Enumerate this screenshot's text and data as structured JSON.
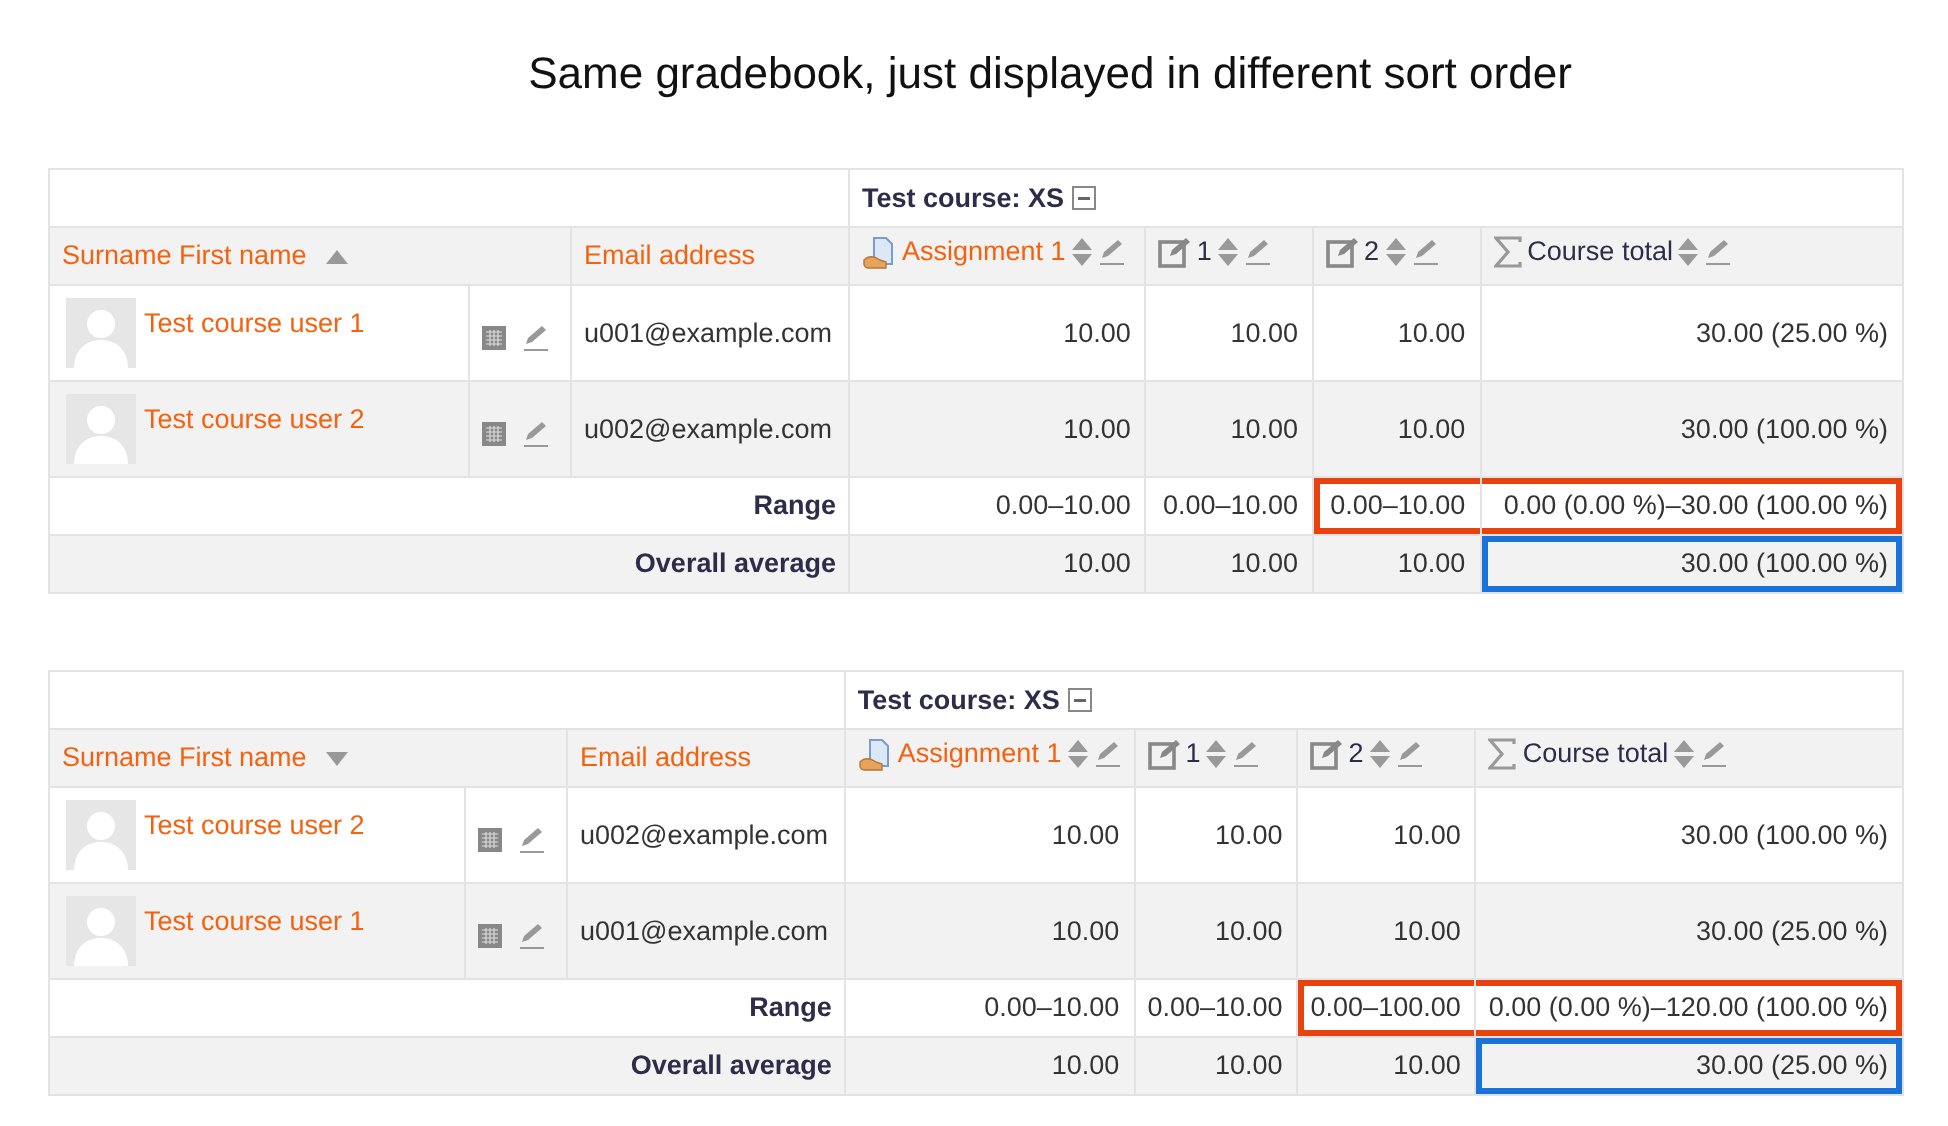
{
  "title": "Same gradebook, just displayed in different sort order",
  "gradebooks": [
    {
      "category": "Test course: XS",
      "name_header": "Surname First name",
      "sort_ascending": true,
      "email_header": "Email address",
      "columns": [
        {
          "kind": "assignment",
          "label": "Assignment 1"
        },
        {
          "kind": "manual",
          "label": "1"
        },
        {
          "kind": "manual",
          "label": "2"
        },
        {
          "kind": "total",
          "label": "Course total"
        }
      ],
      "users": [
        {
          "name": "Test course user 1",
          "email": "u001@example.com",
          "grades": [
            "10.00",
            "10.00",
            "10.00",
            "30.00 (25.00 %)"
          ]
        },
        {
          "name": "Test course user 2",
          "email": "u002@example.com",
          "grades": [
            "10.00",
            "10.00",
            "10.00",
            "30.00 (100.00 %)"
          ]
        }
      ],
      "range": {
        "label": "Range",
        "values": [
          {
            "text": "0.00–10.00",
            "marked": false
          },
          {
            "text": "0.00–10.00",
            "marked": false
          },
          {
            "text": "0.00–10.00",
            "marked": true
          },
          {
            "text": "0.00 (0.00 %)–30.00 (100.00 %)",
            "marked": true
          }
        ]
      },
      "average": {
        "label": "Overall average",
        "values": [
          {
            "text": "10.00",
            "marked": false
          },
          {
            "text": "10.00",
            "marked": false
          },
          {
            "text": "10.00",
            "marked": false
          },
          {
            "text": "30.00 (100.00 %)",
            "marked": true
          }
        ]
      }
    },
    {
      "category": "Test course: XS",
      "name_header": "Surname First name",
      "sort_ascending": false,
      "email_header": "Email address",
      "columns": [
        {
          "kind": "assignment",
          "label": "Assignment 1"
        },
        {
          "kind": "manual",
          "label": "1"
        },
        {
          "kind": "manual",
          "label": "2"
        },
        {
          "kind": "total",
          "label": "Course total"
        }
      ],
      "users": [
        {
          "name": "Test course user 2",
          "email": "u002@example.com",
          "grades": [
            "10.00",
            "10.00",
            "10.00",
            "30.00 (100.00 %)"
          ]
        },
        {
          "name": "Test course user 1",
          "email": "u001@example.com",
          "grades": [
            "10.00",
            "10.00",
            "10.00",
            "30.00 (25.00 %)"
          ]
        }
      ],
      "range": {
        "label": "Range",
        "values": [
          {
            "text": "0.00–10.00",
            "marked": false
          },
          {
            "text": "0.00–10.00",
            "marked": false
          },
          {
            "text": "0.00–100.00",
            "marked": true
          },
          {
            "text": "0.00 (0.00 %)–120.00 (100.00 %)",
            "marked": true
          }
        ]
      },
      "average": {
        "label": "Overall average",
        "values": [
          {
            "text": "10.00",
            "marked": false
          },
          {
            "text": "10.00",
            "marked": false
          },
          {
            "text": "10.00",
            "marked": false
          },
          {
            "text": "30.00 (25.00 %)",
            "marked": true
          }
        ]
      }
    }
  ]
}
